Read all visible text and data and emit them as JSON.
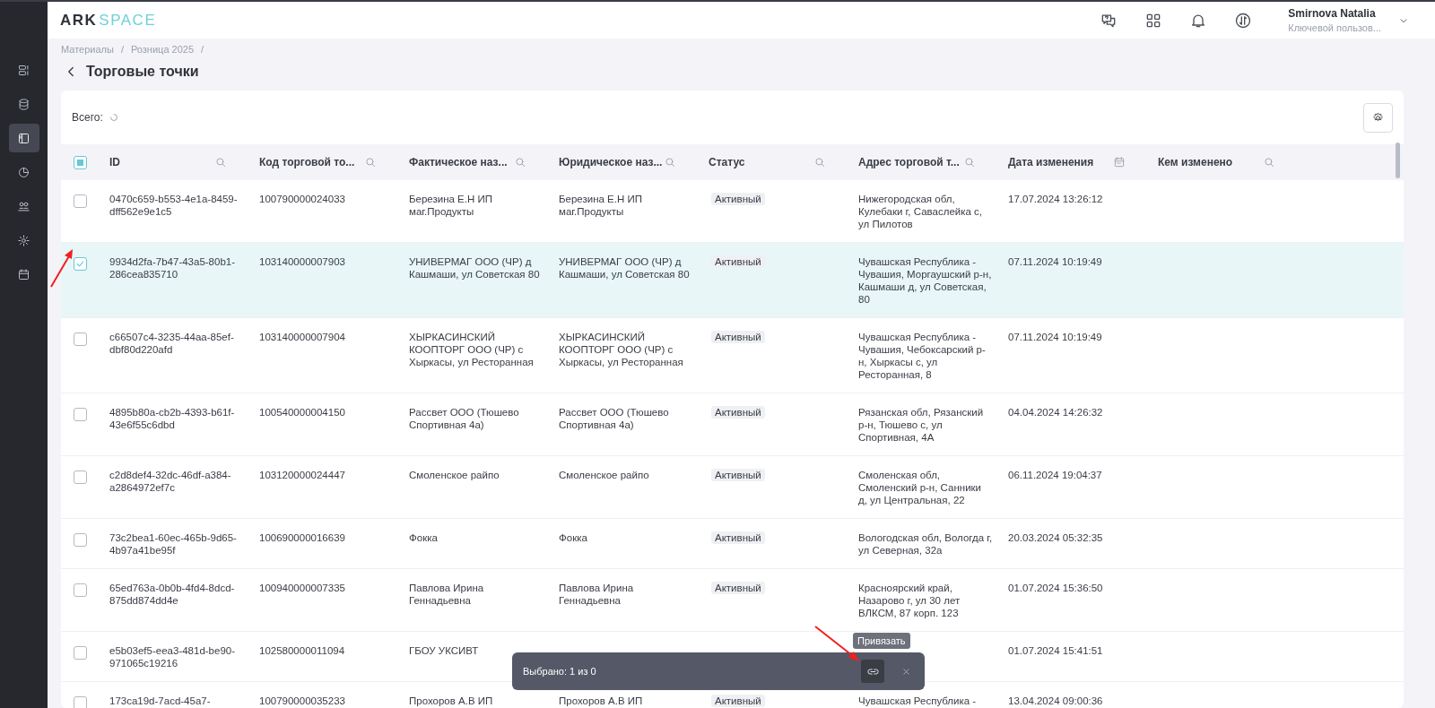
{
  "logo": {
    "dark": "ARK",
    "light": "SPACE"
  },
  "sidebar": {
    "items": [
      {
        "selected": false
      },
      {
        "selected": false
      },
      {
        "selected": true
      },
      {
        "selected": false
      },
      {
        "selected": false
      },
      {
        "selected": false
      },
      {
        "selected": false
      }
    ]
  },
  "user": {
    "name": "Smirnova Natalia",
    "role": "Ключевой пользов..."
  },
  "breadcrumbs": [
    "Материалы",
    "/",
    "Розница 2025",
    "/"
  ],
  "page_title": "Торговые точки",
  "total_label": "Всего:",
  "table": {
    "header_checkbox": {
      "indeterminate": true
    },
    "columns": [
      {
        "label": "ID",
        "kind": "search"
      },
      {
        "label": "Код торговой то...",
        "kind": "search"
      },
      {
        "label": "Фактическое наз...",
        "kind": "search"
      },
      {
        "label": "Юридическое наз...",
        "kind": "search"
      },
      {
        "label": "Статус",
        "kind": "search"
      },
      {
        "label": "Адрес торговой т...",
        "kind": "search"
      },
      {
        "label": "Дата изменения",
        "kind": "date"
      },
      {
        "label": "Кем изменено",
        "kind": "search"
      }
    ],
    "rows": [
      {
        "selected": false,
        "cells": [
          "0470c659-b553-4e1a-8459-dff562e9e1c5",
          "100790000024033",
          "Березина Е.Н ИП маг.Продукты",
          "Березина Е.Н ИП маг.Продукты",
          "Активный",
          "Нижегородская обл, Кулебаки г, Саваслейка с, ул Пилотов",
          "17.07.2024 13:26:12",
          ""
        ]
      },
      {
        "selected": true,
        "cells": [
          "9934d2fa-7b47-43a5-80b1-286cea835710",
          "103140000007903",
          "УНИВЕРМАГ ООО (ЧР) д Кашмаши, ул Советская 80",
          "УНИВЕРМАГ ООО (ЧР) д Кашмаши, ул Советская 80",
          "Активный",
          "Чувашская Республика - Чувашия, Моргаушский р-н, Кашмаши д, ул Советская, 80",
          "07.11.2024 10:19:49",
          ""
        ]
      },
      {
        "selected": false,
        "cells": [
          "c66507c4-3235-44aa-85ef-dbf80d220afd",
          "103140000007904",
          "ХЫРКАСИНСКИЙ КООПТОРГ ООО (ЧР) с Хыркасы, ул Ресторанная",
          "ХЫРКАСИНСКИЙ КООПТОРГ ООО (ЧР) с Хыркасы, ул Ресторанная",
          "Активный",
          "Чувашская Республика - Чувашия, Чебоксарский р-н, Хыркасы с, ул Ресторанная, 8",
          "07.11.2024 10:19:49",
          ""
        ]
      },
      {
        "selected": false,
        "cells": [
          "4895b80a-cb2b-4393-b61f-43e6f55c6dbd",
          "100540000004150",
          "Рассвет ООО (Тюшево Спортивная 4а)",
          "Рассвет ООО (Тюшево Спортивная 4а)",
          "Активный",
          "Рязанская обл, Рязанский р-н, Тюшево с, ул Спортивная, 4А",
          "04.04.2024 14:26:32",
          ""
        ]
      },
      {
        "selected": false,
        "cells": [
          "c2d8def4-32dc-46df-a384-a2864972ef7c",
          "103120000024447",
          "Смоленское райпо",
          "Смоленское райпо",
          "Активный",
          "Смоленская обл, Смоленский р-н, Санники д, ул Центральная, 22",
          "06.11.2024 19:04:37",
          ""
        ]
      },
      {
        "selected": false,
        "cells": [
          "73c2bea1-60ec-465b-9d65-4b97a41be95f",
          "100690000016639",
          "Фокка",
          "Фокка",
          "Активный",
          "Вологодская обл, Вологда г, ул Северная, 32а",
          "20.03.2024 05:32:35",
          ""
        ]
      },
      {
        "selected": false,
        "cells": [
          "65ed763a-0b0b-4fd4-8dcd-875dd874dd4e",
          "100940000007335",
          "Павлова Ирина Геннадьевна",
          "Павлова Ирина Геннадьевна",
          "Активный",
          "Красноярский край, Назарово г, ул 30 лет ВЛКСМ, 87 корп. 123",
          "01.07.2024 15:36:50",
          ""
        ]
      },
      {
        "selected": false,
        "cells": [
          "e5b03ef5-eea3-481d-be90-971065c19216",
          "102580000011094",
          "ГБОУ УКСИВТ",
          null,
          null,
          null,
          "01.07.2024 15:41:51",
          ""
        ]
      },
      {
        "selected": false,
        "cells": [
          "173ca19d-7acd-45a7-",
          "100790000035233",
          "Прохоров А.В ИП",
          "Прохоров А.В ИП",
          "Активный",
          "Чувашская Республика -",
          "13.04.2024 09:00:36",
          ""
        ]
      }
    ]
  },
  "selection_bar": {
    "text": "Выбрано: 1 из 0",
    "tooltip": "Привязать"
  }
}
